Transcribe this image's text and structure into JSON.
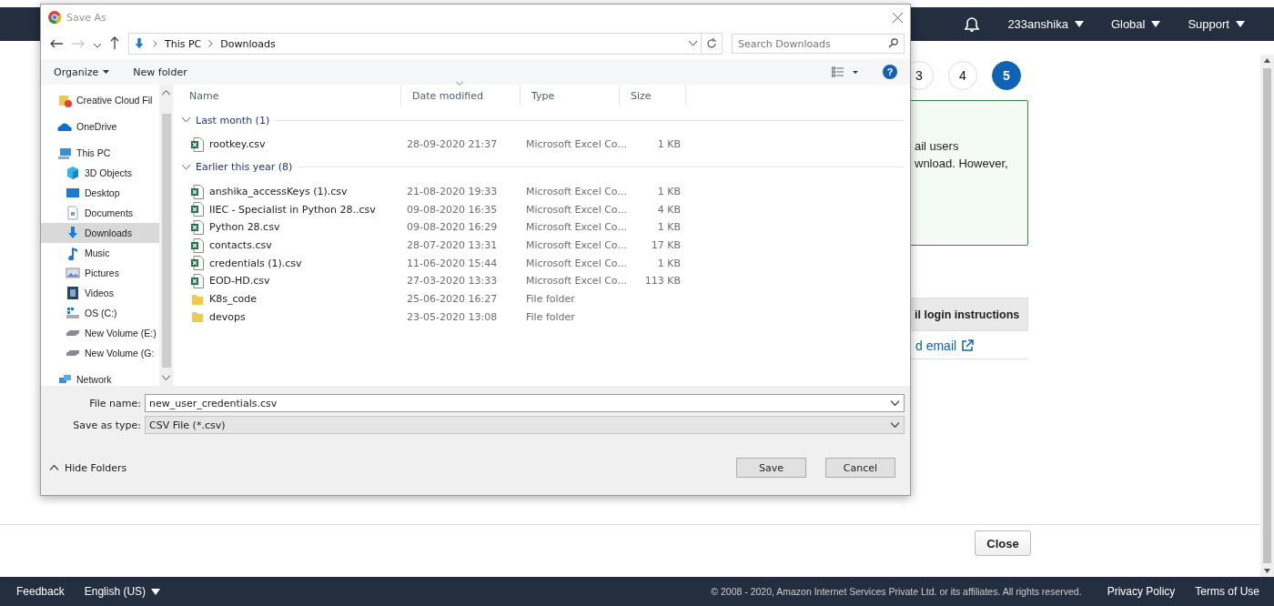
{
  "header": {
    "menus": [
      "233anshika",
      "Global",
      "Support"
    ]
  },
  "steps": [
    {
      "label": "3",
      "selected": false
    },
    {
      "label": "4",
      "selected": false
    },
    {
      "label": "5",
      "selected": true
    }
  ],
  "notice": {
    "lines": [
      "ail users",
      "wnload. However,"
    ]
  },
  "email_button": "il login instructions",
  "email_link": "d email",
  "close_button": "Close",
  "footer": {
    "feedback": "Feedback",
    "language": "English (US)",
    "copyright": "© 2008 - 2020, Amazon Internet Services Private Ltd. or its affiliates. All rights reserved.",
    "links": [
      "Privacy Policy",
      "Terms of Use"
    ]
  },
  "dialog": {
    "title": "Save As",
    "breadcrumb": [
      "This PC",
      "Downloads"
    ],
    "search": {
      "placeholder": "Search Downloads"
    },
    "toolbar": [
      "Organize",
      "New folder"
    ],
    "help": "?",
    "sidebar": [
      {
        "label": "Creative Cloud Fil",
        "selected": false
      },
      {
        "label": "OneDrive",
        "selected": false
      },
      {
        "label": "This PC",
        "selected": false,
        "children": [
          {
            "label": "3D Objects",
            "selected": false
          },
          {
            "label": "Desktop",
            "selected": false
          },
          {
            "label": "Documents",
            "selected": false
          },
          {
            "label": "Downloads",
            "selected": true
          },
          {
            "label": "Music",
            "selected": false
          },
          {
            "label": "Pictures",
            "selected": false
          },
          {
            "label": "Videos",
            "selected": false
          },
          {
            "label": "OS (C:)",
            "selected": false
          },
          {
            "label": "New Volume (E:)",
            "selected": false
          },
          {
            "label": "New Volume (G:",
            "selected": false
          }
        ]
      },
      {
        "label": "Network",
        "selected": false
      }
    ],
    "columns": [
      "Name",
      "Date modified",
      "Type",
      "Size"
    ],
    "groups": [
      {
        "label": "Last month (1)",
        "expanded": true,
        "files": [
          {
            "name": "rootkey.csv",
            "date": "28-09-2020 21:37",
            "type": "Microsoft Excel Co...",
            "size": "1 KB",
            "kind": "csv"
          }
        ]
      },
      {
        "label": "Earlier this year (8)",
        "expanded": true,
        "files": [
          {
            "name": "anshika_accessKeys (1).csv",
            "date": "21-08-2020 19:33",
            "type": "Microsoft Excel Co...",
            "size": "1 KB",
            "kind": "csv"
          },
          {
            "name": "IIEC  - Specialist in Python 28..csv",
            "date": "09-08-2020 16:35",
            "type": "Microsoft Excel Co...",
            "size": "4 KB",
            "kind": "csv"
          },
          {
            "name": "Python 28.csv",
            "date": "09-08-2020 16:29",
            "type": "Microsoft Excel Co...",
            "size": "1 KB",
            "kind": "csv"
          },
          {
            "name": "contacts.csv",
            "date": "28-07-2020 13:31",
            "type": "Microsoft Excel Co...",
            "size": "17 KB",
            "kind": "csv"
          },
          {
            "name": "credentials (1).csv",
            "date": "11-06-2020 15:44",
            "type": "Microsoft Excel Co...",
            "size": "1 KB",
            "kind": "csv"
          },
          {
            "name": "EOD-HD.csv",
            "date": "27-03-2020 13:33",
            "type": "Microsoft Excel Co...",
            "size": "113 KB",
            "kind": "csv"
          },
          {
            "name": "K8s_code",
            "date": "25-06-2020 16:27",
            "type": "File folder",
            "kind": "folder"
          },
          {
            "name": "devops",
            "date": "23-05-2020 13:08",
            "type": "File folder",
            "kind": "folder"
          }
        ]
      }
    ],
    "file_name": {
      "label": "File name:",
      "value": "new_user_credentials.csv"
    },
    "save_type": {
      "label": "Save as type:",
      "value": "CSV File (*.csv)"
    },
    "hide_folders": "Hide Folders",
    "buttons": [
      "Save",
      "Cancel"
    ]
  }
}
